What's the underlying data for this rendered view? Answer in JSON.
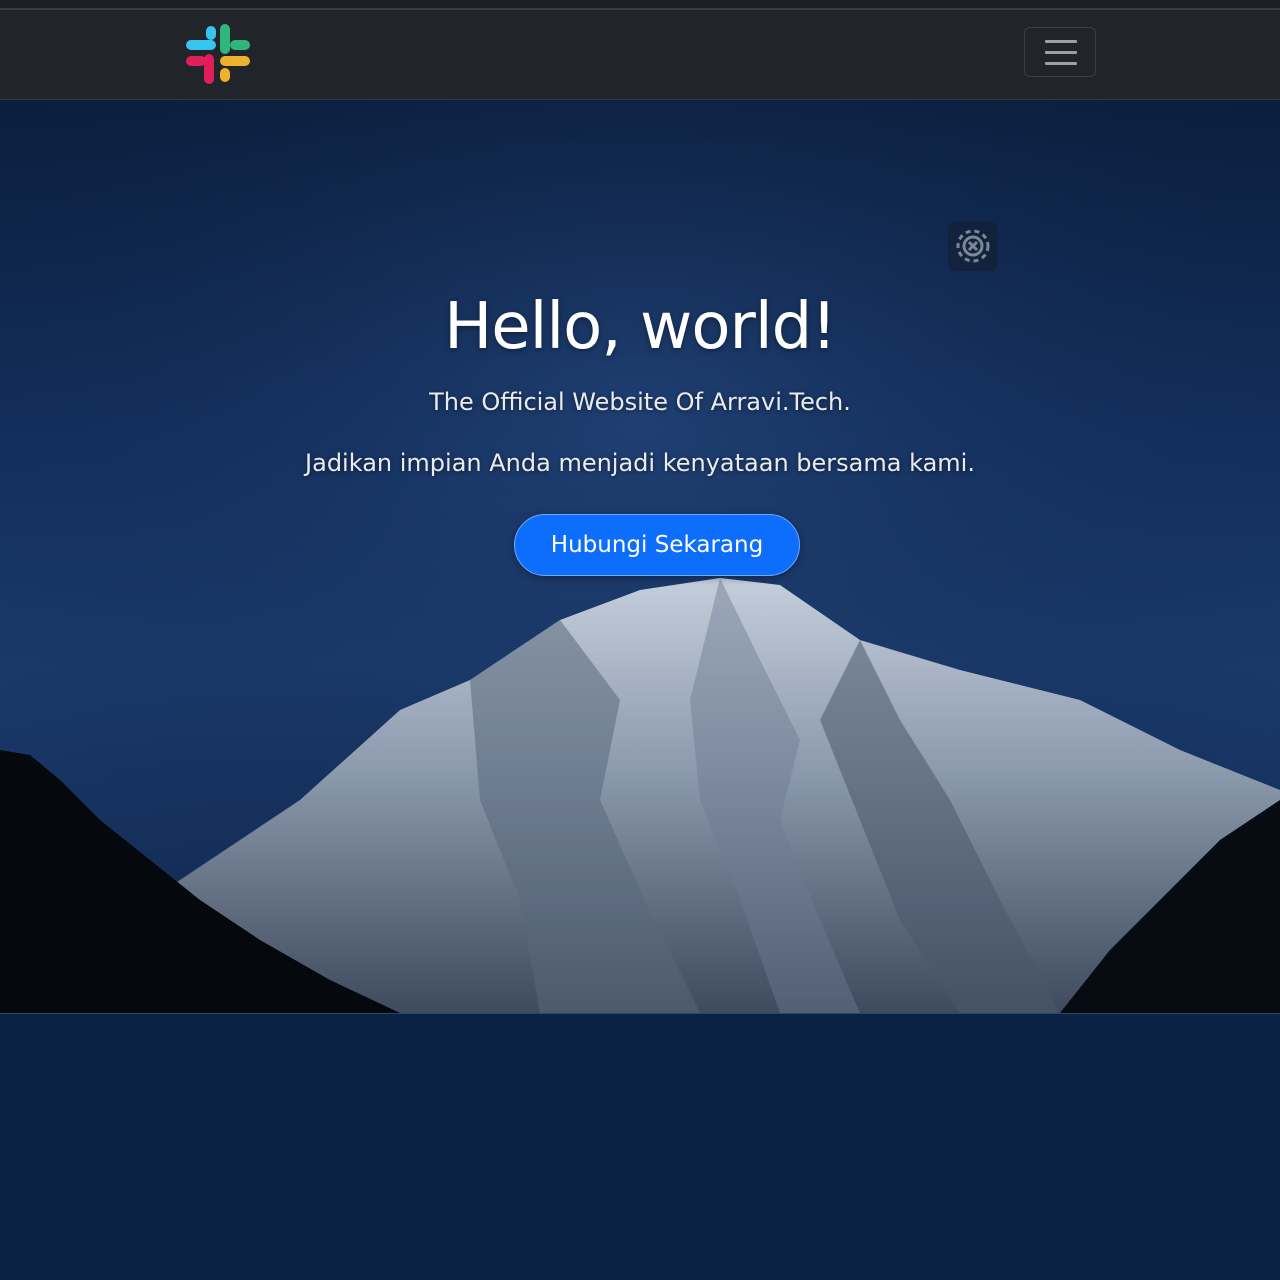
{
  "navbar": {
    "logo_icon": "slack-logo-icon",
    "toggler_icon": "hamburger-menu-icon",
    "colors": {
      "background": "#212529",
      "logo_blue": "#36c5f0",
      "logo_green": "#2eb67d",
      "logo_red": "#e01e5a",
      "logo_yellow": "#ecb22e"
    }
  },
  "hero": {
    "title": "Hello, world!",
    "subtitle": "The Official Website Of Arravi.Tech.",
    "tagline": "Jadikan impian Anda menjadi kenyataan bersama kami.",
    "cta_label": "Hubungi Sekarang",
    "settings_icon": "gear-icon",
    "colors": {
      "cta_background": "#0d6efd",
      "text": "#ffffff"
    }
  },
  "page": {
    "lower_background": "#0a2244"
  }
}
